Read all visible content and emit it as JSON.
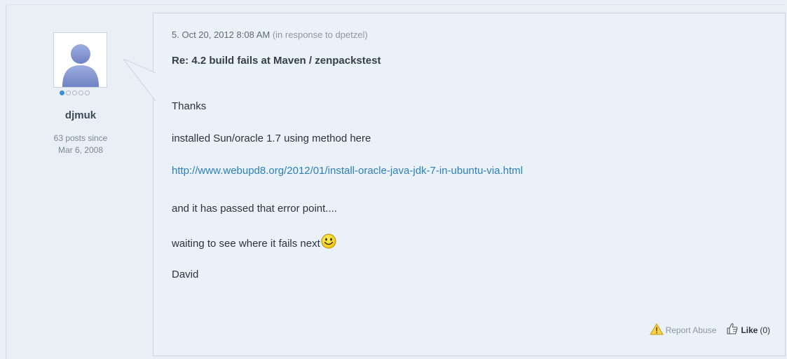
{
  "post": {
    "number": "5.",
    "date": "Oct 20, 2012 8:08 AM",
    "in_response_to": "(in response to dpetzel)",
    "subject": "Re: 4.2 build fails at Maven / zenpackstest",
    "body": {
      "line1": "Thanks",
      "line2": "installed Sun/oracle 1.7 using method here",
      "link": "http://www.webupd8.org/2012/01/install-oracle-java-jdk-7-in-ubuntu-via.html",
      "line4": "and it has passed that error point....",
      "line5": "waiting to see where it fails next",
      "line6": "David"
    },
    "actions": {
      "report_abuse": "Report Abuse",
      "like_label": "Like",
      "like_count": "(0)"
    }
  },
  "author": {
    "username": "djmuk",
    "posts_line1": "63 posts since",
    "posts_line2": "Mar 6, 2008",
    "status_level": 1,
    "status_max": 5
  },
  "colors": {
    "background": "#e9eff5",
    "bubble": "#eaf1f8",
    "link": "#2e7fb8",
    "status_on": "#3d8ed6"
  },
  "icons": {
    "avatar": "default-user-avatar-icon",
    "smiley": "smiley-emoticon-icon",
    "warning": "warning-triangle-icon",
    "like": "thumbs-up-icon"
  }
}
